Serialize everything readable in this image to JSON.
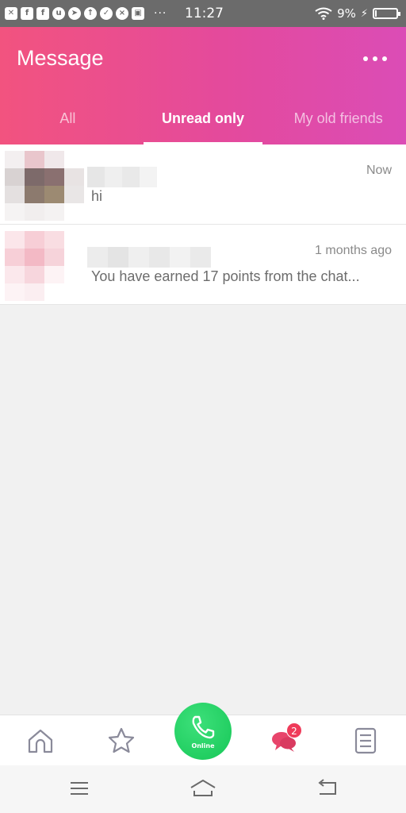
{
  "status_bar": {
    "time": "11:27",
    "battery_percent": "9%",
    "battery_level": 0.09,
    "notification_icons": [
      "x-icon",
      "facebook-icon",
      "facebook-icon",
      "uc-icon",
      "telegram-icon",
      "upload-icon",
      "check-icon",
      "close-circle-icon",
      "image-icon"
    ],
    "overflow": "···"
  },
  "header": {
    "title": "Message",
    "more_icon": "more-dots-icon",
    "tabs": [
      {
        "label": "All",
        "active": false
      },
      {
        "label": "Unread only",
        "active": true
      },
      {
        "label": "My old friends",
        "active": false
      }
    ]
  },
  "messages": [
    {
      "time": "Now",
      "preview": "hi"
    },
    {
      "time": "1 months ago",
      "preview": "You have earned 17 points from the chat..."
    }
  ],
  "bottom_nav": {
    "items": [
      "home-icon",
      "star-icon",
      "phone-icon",
      "chat-icon",
      "contacts-icon"
    ],
    "call_label": "Online",
    "chat_badge": "2",
    "accent": "#ef3b5a",
    "call_color": "#16c757"
  },
  "colors": {
    "header_start": "#f2537f",
    "header_end": "#db4cb6"
  }
}
